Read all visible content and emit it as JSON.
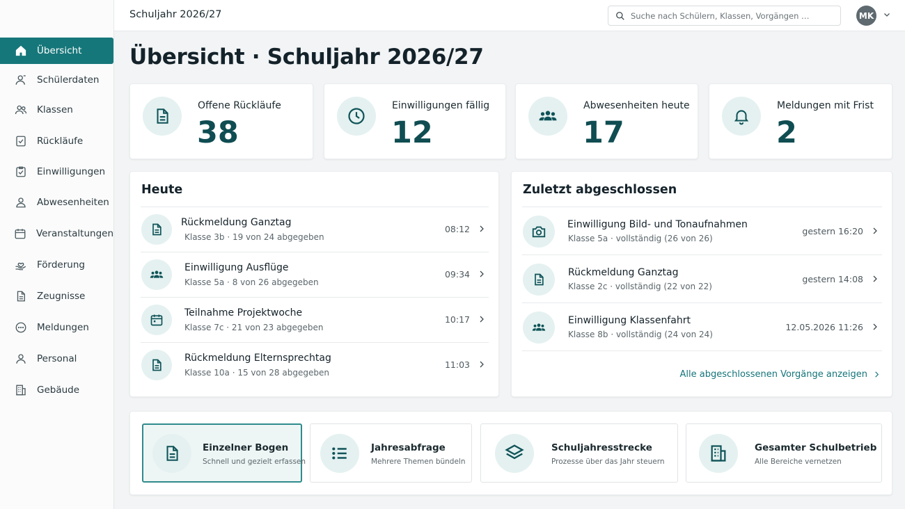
{
  "colors": {
    "accent": "#16777a",
    "accent_dark": "#0f4d52",
    "icon_bg": "#e4f1f0",
    "page_bg": "#f2f4f5"
  },
  "topbar": {
    "title": "Schuljahr 2026/27",
    "search_placeholder": "Suche nach Schülern, Klassen, Vorgängen …",
    "avatar_initials": "MK"
  },
  "sidebar": {
    "items": [
      {
        "label": "Übersicht",
        "icon": "home-icon",
        "active": true
      },
      {
        "label": "Schülerdaten",
        "icon": "user-icon"
      },
      {
        "label": "Klassen",
        "icon": "users-icon"
      },
      {
        "label": "Rückläufe",
        "icon": "checkbox-icon"
      },
      {
        "label": "Einwilligungen",
        "icon": "clipboard-check-icon"
      },
      {
        "label": "Abwesenheiten",
        "icon": "user-absent-icon"
      },
      {
        "label": "Veranstaltungen",
        "icon": "calendar-icon"
      },
      {
        "label": "Förderung",
        "icon": "hand-heart-icon"
      },
      {
        "label": "Zeugnisse",
        "icon": "document-icon"
      },
      {
        "label": "Meldungen",
        "icon": "message-icon"
      },
      {
        "label": "Personal",
        "icon": "person-icon"
      },
      {
        "label": "Gebäude",
        "icon": "building-icon"
      }
    ]
  },
  "page": {
    "title": "Übersicht · Schuljahr 2026/27"
  },
  "kpis": [
    {
      "label": "Offene Rückläufe",
      "value": "38",
      "icon": "document-icon"
    },
    {
      "label": "Einwilligungen fällig",
      "value": "12",
      "icon": "clock-icon"
    },
    {
      "label": "Abwesenheiten heute",
      "value": "17",
      "icon": "group-icon"
    },
    {
      "label": "Meldungen mit Frist",
      "value": "2",
      "icon": "bell-icon"
    }
  ],
  "today": {
    "title": "Heute",
    "items": [
      {
        "title": "Rückmeldung Ganztag",
        "sub": "Klasse 3b  ·  19 von 24 abgegeben",
        "time": "08:12",
        "icon": "document-icon"
      },
      {
        "title": "Einwilligung Ausflüge",
        "sub": "Klasse 5a  ·  8 von 26 abgegeben",
        "time": "09:34",
        "icon": "group-icon"
      },
      {
        "title": "Teilnahme Projektwoche",
        "sub": "Klasse 7c  ·  21 von 23 abgegeben",
        "time": "10:17",
        "icon": "calendar-icon"
      },
      {
        "title": "Rückmeldung Elternsprechtag",
        "sub": "Klasse 10a  ·  15 von 28 abgegeben",
        "time": "11:03",
        "icon": "document-icon"
      }
    ]
  },
  "recent": {
    "title": "Zuletzt abgeschlossen",
    "items": [
      {
        "title": "Einwilligung Bild- und Tonaufnahmen",
        "sub": "Klasse 5a  ·  vollständig (26 von 26)",
        "time": "gestern 16:20",
        "icon": "camera-icon"
      },
      {
        "title": "Rückmeldung Ganztag",
        "sub": "Klasse 2c  ·  vollständig (22 von 22)",
        "time": "gestern 14:08",
        "icon": "document-icon"
      },
      {
        "title": "Einwilligung Klassenfahrt",
        "sub": "Klasse 8b  ·  vollständig (24 von 24)",
        "time": "12.05.2026  11:26",
        "icon": "group-icon"
      }
    ],
    "show_all": "Alle abgeschlossenen Vorgänge anzeigen"
  },
  "tiles": [
    {
      "title": "Einzelner Bogen",
      "sub": "Schnell und gezielt erfassen",
      "icon": "document-icon",
      "selected": true
    },
    {
      "title": "Jahresabfrage",
      "sub": "Mehrere Themen bündeln",
      "icon": "list-icon"
    },
    {
      "title": "Schuljahresstrecke",
      "sub": "Prozesse über das Jahr steuern",
      "icon": "layers-icon"
    },
    {
      "title": "Gesamter Schulbetrieb",
      "sub": "Alle Bereiche vernetzen",
      "icon": "building-icon"
    }
  ]
}
